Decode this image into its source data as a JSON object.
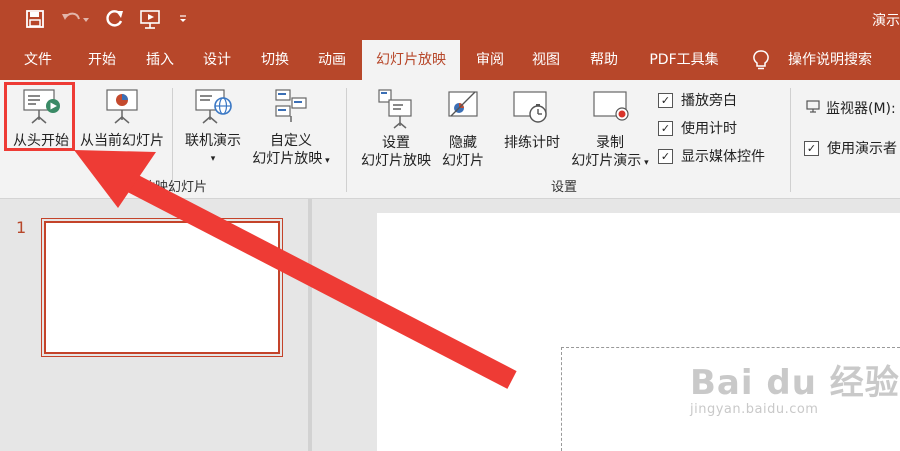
{
  "titlebar": {
    "title": "演示"
  },
  "tabs": [
    {
      "label": "文件"
    },
    {
      "label": "开始"
    },
    {
      "label": "插入"
    },
    {
      "label": "设计"
    },
    {
      "label": "切换"
    },
    {
      "label": "动画"
    },
    {
      "label": "幻灯片放映"
    },
    {
      "label": "审阅"
    },
    {
      "label": "视图"
    },
    {
      "label": "帮助"
    },
    {
      "label": "PDF工具集"
    },
    {
      "label": "操作说明搜索"
    }
  ],
  "ribbon": {
    "start_group": {
      "from_beginning": "从头开始",
      "from_current": "从当前幻灯片",
      "online": "联机演示",
      "custom_line1": "自定义",
      "custom_line2": "幻灯片放映",
      "label": "开始放映幻灯片"
    },
    "setup_group": {
      "setup_line1": "设置",
      "setup_line2": "幻灯片放映",
      "hide_line1": "隐藏",
      "hide_line2": "幻灯片",
      "rehearse": "排练计时",
      "record_line1": "录制",
      "record_line2": "幻灯片演示",
      "play_narration": "播放旁白",
      "use_timings": "使用计时",
      "show_media_controls": "显示媒体控件",
      "label": "设置"
    },
    "monitors_group": {
      "monitor": "监视器(M):",
      "presenter_view": "使用演示者"
    }
  },
  "slides": {
    "number": "1"
  },
  "watermark": {
    "main": "Bai du 经验",
    "sub": "jingyan.baidu.com"
  },
  "colors": {
    "accent": "#b7472a",
    "highlight": "#ee3b35"
  }
}
